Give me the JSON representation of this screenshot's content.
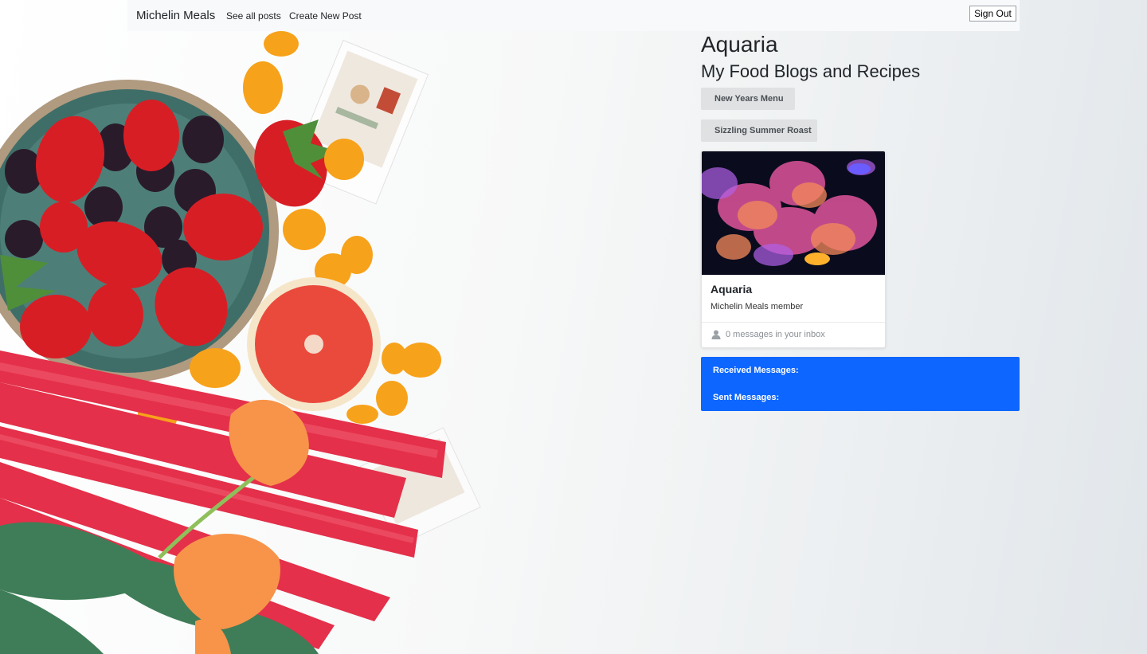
{
  "navbar": {
    "brand": "Michelin Meals",
    "links": [
      "See all posts",
      "Create New Post"
    ],
    "sign_out": "Sign Out"
  },
  "profile": {
    "name": "Aquaria",
    "blog_heading": "My Food Blogs and Recipes",
    "posts": [
      "New Years Menu",
      "Sizzling Summer Roast"
    ]
  },
  "card": {
    "name": "Aquaria",
    "subtitle": "Michelin Meals member",
    "inbox_text": "0 messages in your inbox",
    "inbox_icon": "person-icon"
  },
  "messages": {
    "received_label": "Received Messages:",
    "sent_label": "Sent Messages:"
  },
  "colors": {
    "accent": "#0d66ff",
    "navbar_bg": "#f8f9fa",
    "post_button_bg": "#dfe1e3"
  }
}
